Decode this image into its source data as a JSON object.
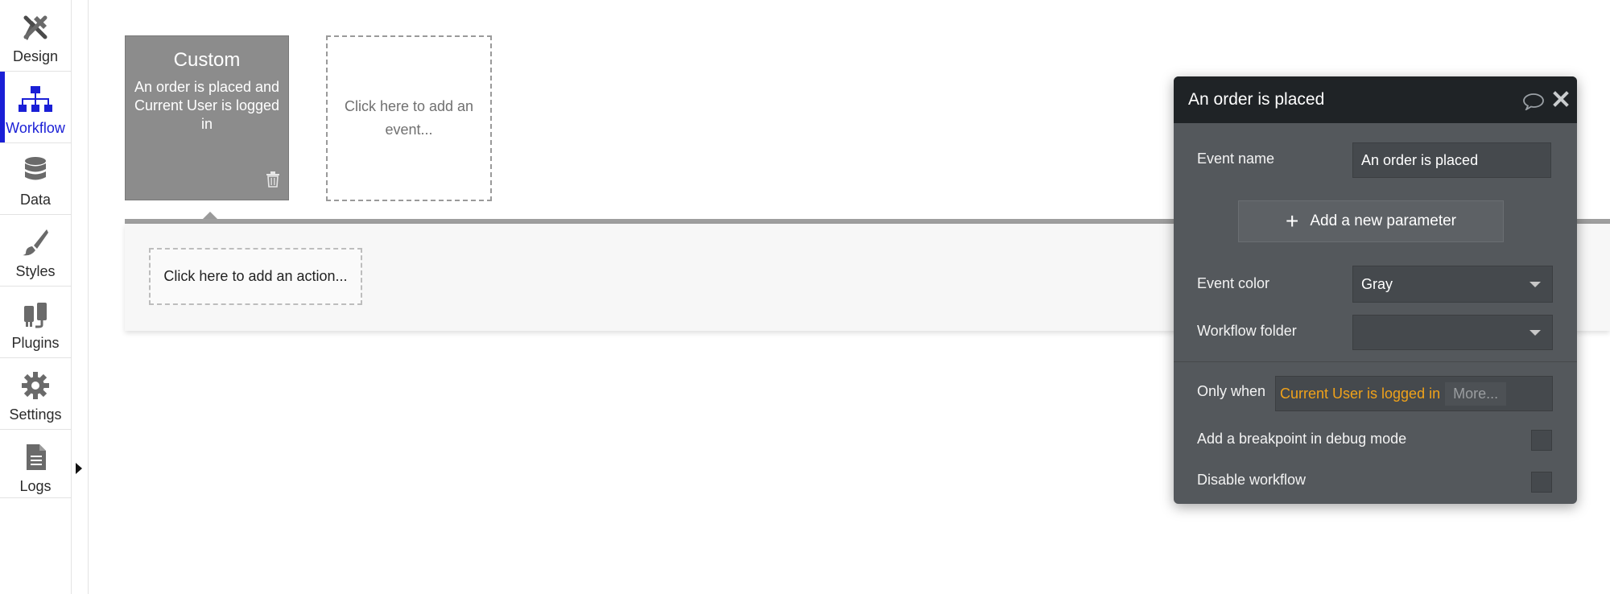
{
  "nav": {
    "items": [
      {
        "label": "Design",
        "icon": "design-icon"
      },
      {
        "label": "Workflow",
        "icon": "workflow-icon",
        "active": true
      },
      {
        "label": "Data",
        "icon": "database-icon"
      },
      {
        "label": "Styles",
        "icon": "brush-icon"
      },
      {
        "label": "Plugins",
        "icon": "plug-icon"
      },
      {
        "label": "Settings",
        "icon": "gear-icon"
      },
      {
        "label": "Logs",
        "icon": "document-icon"
      }
    ]
  },
  "canvas": {
    "event_card": {
      "title": "Custom",
      "description": "An order is placed and Current User is logged in",
      "color": "#8c8c8c"
    },
    "add_event_label": "Click here to add an event...",
    "add_action_label": "Click here to add an action..."
  },
  "panel": {
    "title": "An order is placed",
    "event_name_label": "Event name",
    "event_name_value": "An order is placed",
    "add_parameter_label": "Add a new parameter",
    "event_color_label": "Event color",
    "event_color_value": "Gray",
    "workflow_folder_label": "Workflow folder",
    "workflow_folder_value": "",
    "only_when_label": "Only when",
    "only_when_condition": "Current User is logged in",
    "only_when_more": "More...",
    "breakpoint_label": "Add a breakpoint in debug mode",
    "breakpoint_checked": false,
    "disable_label": "Disable workflow",
    "disable_checked": false
  },
  "colors": {
    "accent": "#1a1fd6",
    "condition": "#f0a21a",
    "panel_bg": "#54585c",
    "panel_header": "#1f2326"
  }
}
